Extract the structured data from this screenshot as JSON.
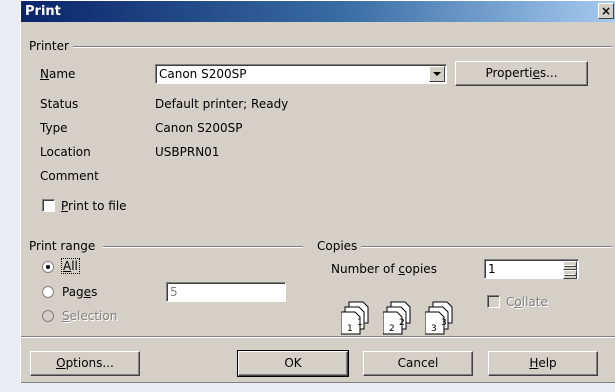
{
  "window": {
    "title": "Print",
    "close_glyph": "×"
  },
  "printer": {
    "group_label": "Printer",
    "name_label_u": "N",
    "name_label_rest": "ame",
    "name_value": "Canon S200SP",
    "properties_pre": "Properti",
    "properties_u": "e",
    "properties_post": "s...",
    "status_label": "Status",
    "status_value": "Default printer; Ready",
    "type_label": "Type",
    "type_value": "Canon S200SP",
    "location_label": "Location",
    "location_value": "USBPRN01",
    "comment_label": "Comment",
    "print_to_file_u": "P",
    "print_to_file_rest": "rint to file"
  },
  "print_range": {
    "group_label": "Print range",
    "all_u": "A",
    "all_rest": "ll",
    "pages_pre": "Pag",
    "pages_u": "e",
    "pages_post": "s",
    "pages_value": "5",
    "selection_u": "S",
    "selection_rest": "election"
  },
  "copies": {
    "group_label": "Copies",
    "number_pre": "Number of ",
    "number_u": "c",
    "number_post": "opies",
    "number_value": "1",
    "collate_pre": "C",
    "collate_u": "o",
    "collate_post": "llate"
  },
  "footer": {
    "options_u": "O",
    "options_rest": "ptions...",
    "ok_label": "OK",
    "cancel_label": "Cancel",
    "help_u": "H",
    "help_rest": "elp"
  },
  "icons": {
    "copies_collate": "three-page-stacks-icon"
  }
}
